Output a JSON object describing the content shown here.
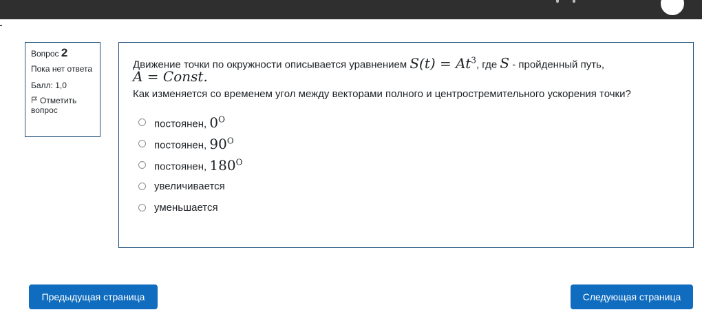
{
  "question_info": {
    "title_prefix": "Вопрос",
    "number": "2",
    "state": "Пока нет ответа",
    "grade": "Балл: 1,0",
    "flag_label": "Отметить вопрос"
  },
  "question": {
    "text_before_formula": "Движение точки по окружности описывается уравнением ",
    "formula_s": "S(t) = At",
    "formula_exp": "3",
    "text_where": ", где ",
    "var_s": "S",
    "text_path": " - пройденный путь,",
    "const_formula": "A = Const.",
    "text_question": "Как изменяется со временем угол между векторами полного и центростремительного ускорения точки?"
  },
  "answers": [
    {
      "label": "постоянен, ",
      "deg": "0",
      "sup": "O"
    },
    {
      "label": "постоянен, ",
      "deg": "90",
      "sup": "O"
    },
    {
      "label": "постоянен, ",
      "deg": "180",
      "sup": "O"
    },
    {
      "label": "увеличивается",
      "deg": "",
      "sup": ""
    },
    {
      "label": "уменьшается",
      "deg": "",
      "sup": ""
    }
  ],
  "navigation": {
    "prev_label": "Предыдущая страница",
    "next_label": "Следующая страница"
  },
  "colors": {
    "topbar": "#2f2f2f",
    "border": "#1d4f7a",
    "button": "#0f6cbf"
  }
}
